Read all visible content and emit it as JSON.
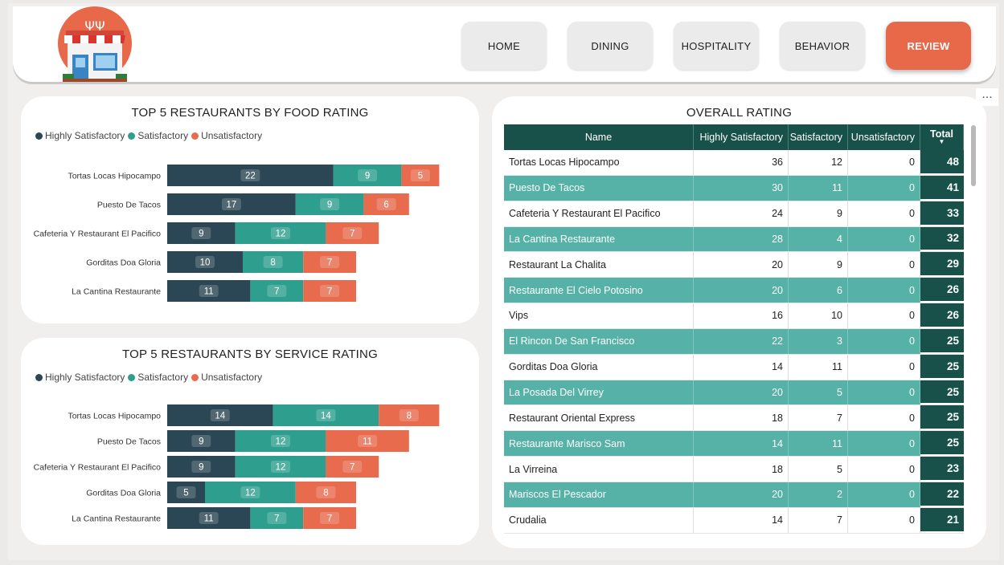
{
  "nav": {
    "items": [
      {
        "label": "HOME",
        "active": false
      },
      {
        "label": "DINING",
        "active": false
      },
      {
        "label": "HOSPITALITY",
        "active": false
      },
      {
        "label": "BEHAVIOR",
        "active": false
      },
      {
        "label": "REVIEW",
        "active": true
      }
    ]
  },
  "more_menu": "...",
  "colors": {
    "highly_satisfactory": "#2b4654",
    "satisfactory": "#2e9f8e",
    "unsatisfactory": "#e86b4d",
    "table_header": "#17514a",
    "table_alt_row": "#56b1a6",
    "active_nav": "#e8694a"
  },
  "legend": {
    "highly": "Highly Satisfactory",
    "satisfactory": "Satisfactory",
    "unsatisfactory": "Unsatisfactory"
  },
  "chart_data": [
    {
      "type": "bar",
      "orientation": "horizontal-stacked",
      "title": "TOP 5 RESTAURANTS BY FOOD RATING",
      "categories": [
        "Tortas Locas Hipocampo",
        "Puesto De Tacos",
        "Cafeteria Y Restaurant El Pacifico",
        "Gorditas Doa Gloria",
        "La Cantina Restaurante"
      ],
      "series": [
        {
          "name": "Highly Satisfactory",
          "values": [
            22,
            17,
            9,
            10,
            11
          ]
        },
        {
          "name": "Satisfactory",
          "values": [
            9,
            9,
            12,
            8,
            7
          ]
        },
        {
          "name": "Unsatisfactory",
          "values": [
            5,
            6,
            7,
            7,
            7
          ]
        }
      ],
      "legend_position": "top-left",
      "grid": false
    },
    {
      "type": "bar",
      "orientation": "horizontal-stacked",
      "title": "TOP 5 RESTAURANTS BY SERVICE RATING",
      "categories": [
        "Tortas Locas Hipocampo",
        "Puesto De Tacos",
        "Cafeteria Y Restaurant El Pacifico",
        "Gorditas Doa Gloria",
        "La Cantina Restaurante"
      ],
      "series": [
        {
          "name": "Highly Satisfactory",
          "values": [
            14,
            9,
            9,
            5,
            11
          ]
        },
        {
          "name": "Satisfactory",
          "values": [
            14,
            12,
            12,
            12,
            7
          ]
        },
        {
          "name": "Unsatisfactory",
          "values": [
            8,
            11,
            7,
            8,
            7
          ]
        }
      ],
      "legend_position": "top-left",
      "grid": false
    }
  ],
  "overall": {
    "title": "OVERALL RATING",
    "columns": {
      "name": "Name",
      "hs": "Highly Satisfactory",
      "s": "Satisfactory",
      "u": "Unsatisfactory",
      "total": "Total"
    },
    "rows": [
      {
        "name": "Tortas Locas Hipocampo",
        "hs": "36",
        "s": "12",
        "u": "0",
        "total": "48"
      },
      {
        "name": "Puesto De Tacos",
        "hs": "30",
        "s": "11",
        "u": "0",
        "total": "41"
      },
      {
        "name": "Cafeteria Y Restaurant El Pacifico",
        "hs": "24",
        "s": "9",
        "u": "0",
        "total": "33"
      },
      {
        "name": "La Cantina Restaurante",
        "hs": "28",
        "s": "4",
        "u": "0",
        "total": "32"
      },
      {
        "name": "Restaurant La Chalita",
        "hs": "20",
        "s": "9",
        "u": "0",
        "total": "29"
      },
      {
        "name": "Restaurante El Cielo Potosino",
        "hs": "20",
        "s": "6",
        "u": "0",
        "total": "26"
      },
      {
        "name": "Vips",
        "hs": "16",
        "s": "10",
        "u": "0",
        "total": "26"
      },
      {
        "name": "El Rincon De San Francisco",
        "hs": "22",
        "s": "3",
        "u": "0",
        "total": "25"
      },
      {
        "name": "Gorditas Doa Gloria",
        "hs": "14",
        "s": "11",
        "u": "0",
        "total": "25"
      },
      {
        "name": "La Posada Del Virrey",
        "hs": "20",
        "s": "5",
        "u": "0",
        "total": "25"
      },
      {
        "name": "Restaurant Oriental Express",
        "hs": "18",
        "s": "7",
        "u": "0",
        "total": "25"
      },
      {
        "name": "Restaurante Marisco Sam",
        "hs": "14",
        "s": "11",
        "u": "0",
        "total": "25"
      },
      {
        "name": "La Virreina",
        "hs": "18",
        "s": "5",
        "u": "0",
        "total": "23"
      },
      {
        "name": "Mariscos El Pescador",
        "hs": "20",
        "s": "2",
        "u": "0",
        "total": "22"
      },
      {
        "name": "Crudalia",
        "hs": "14",
        "s": "7",
        "u": "0",
        "total": "21"
      }
    ]
  }
}
